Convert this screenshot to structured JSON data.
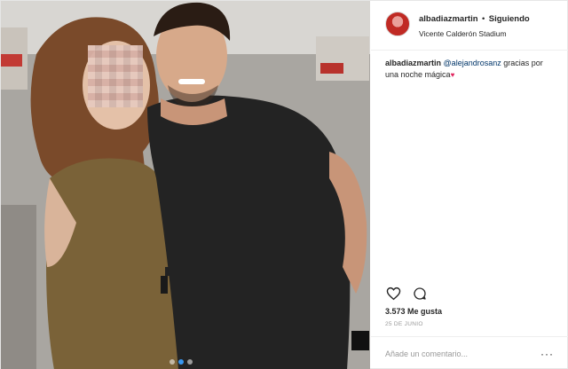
{
  "post": {
    "author": {
      "username": "albadiazmartin",
      "separator": "•",
      "follow_status": "Siguiendo",
      "location": "Vicente Calderón Stadium"
    },
    "caption": {
      "username": "albadiazmartin",
      "mention": "@alejandrosanz",
      "text": " gracias por una noche mágica"
    },
    "likes": "3.573 Me gusta",
    "date": "25 DE JUNIO",
    "comment": {
      "placeholder": "Añade un comentario..."
    },
    "carousel": {
      "count": 3,
      "active_index": 1
    },
    "icons": {
      "like": "heart-outline-icon",
      "comment": "speech-bubble-icon",
      "more": "ellipsis-icon"
    },
    "colors": {
      "accent": "#3897f0",
      "text": "#262626",
      "muted": "#999999",
      "mention": "#003569"
    }
  }
}
